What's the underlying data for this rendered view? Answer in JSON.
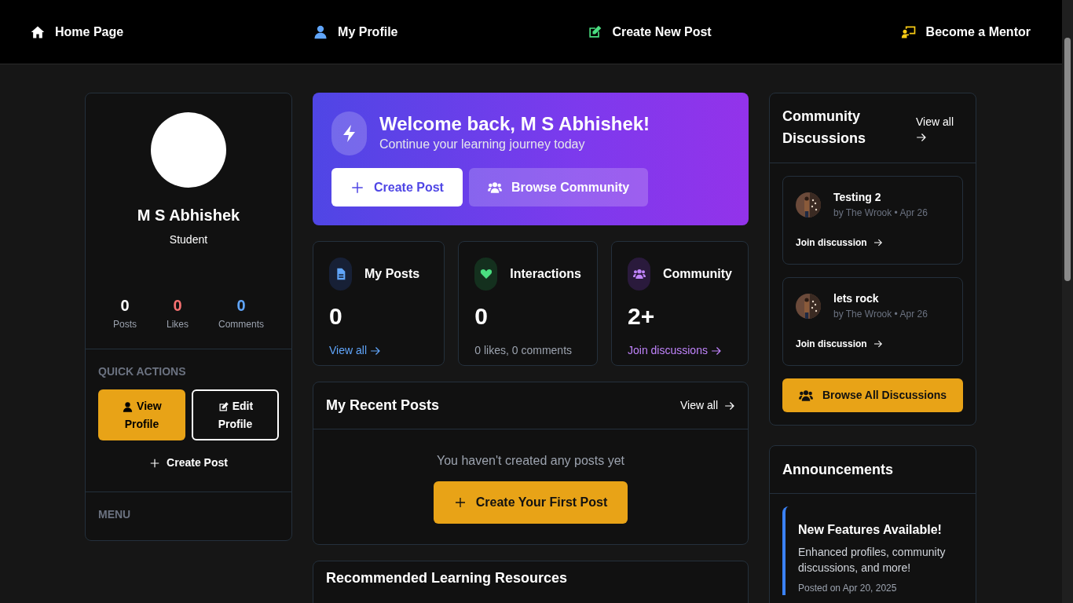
{
  "nav": {
    "items": [
      {
        "label": "Home Page",
        "color": "#ffffff"
      },
      {
        "label": "My Profile",
        "color": "#60a5fa"
      },
      {
        "label": "Create New Post",
        "color": "#4ade80"
      },
      {
        "label": "Become a Mentor",
        "color": "#facc15"
      }
    ]
  },
  "profile": {
    "name": "M S Abhishek",
    "role": "Student",
    "stats": [
      {
        "value": "0",
        "label": "Posts",
        "color": "#ffffff"
      },
      {
        "value": "0",
        "label": "Likes",
        "color": "#f87171"
      },
      {
        "value": "0",
        "label": "Comments",
        "color": "#60a5fa"
      }
    ],
    "quick_actions": {
      "heading": "QUICK ACTIONS",
      "buttons": [
        {
          "label": "View Profile",
          "kind": "primary"
        },
        {
          "label": "Edit Profile",
          "kind": "outline"
        }
      ],
      "link": "Create Post"
    },
    "menu": {
      "heading": "MENU"
    }
  },
  "welcome": {
    "title": "Welcome back, M S Abhishek!",
    "subtitle": "Continue your learning journey today",
    "buttons": [
      {
        "label": "Create Post",
        "kind": "light"
      },
      {
        "label": "Browse Community",
        "kind": "translucent"
      }
    ]
  },
  "stat_cards": [
    {
      "title": "My Posts",
      "color": "#60a5fa",
      "value": "0",
      "footer": "View all",
      "kind": "link"
    },
    {
      "title": "Interactions",
      "color": "#4ade80",
      "value": "0",
      "footer": "0 likes, 0 comments",
      "kind": "text"
    },
    {
      "title": "Community",
      "color": "#c084fc",
      "value": "2+",
      "footer": "Join discussions",
      "kind": "link"
    }
  ],
  "recent_posts": {
    "title": "My Recent Posts",
    "view_all": "View all",
    "empty_text": "You haven't created any posts yet",
    "button": "Create Your First Post"
  },
  "recommended": {
    "title": "Recommended Learning Resources"
  },
  "discussions": {
    "title": "Community Discussions",
    "view_all": "View all",
    "items": [
      {
        "title": "Testing 2",
        "meta": "by The Wrook • Apr 26",
        "action": "Join discussion"
      },
      {
        "title": "lets rock",
        "meta": "by The Wrook • Apr 26",
        "action": "Join discussion"
      }
    ],
    "button": "Browse All Discussions"
  },
  "announcements": {
    "title": "Announcements",
    "items": [
      {
        "title": "New Features Available!",
        "body": "Enhanced profiles, community discussions, and more!",
        "date": "Posted on Apr 20, 2025"
      }
    ]
  }
}
